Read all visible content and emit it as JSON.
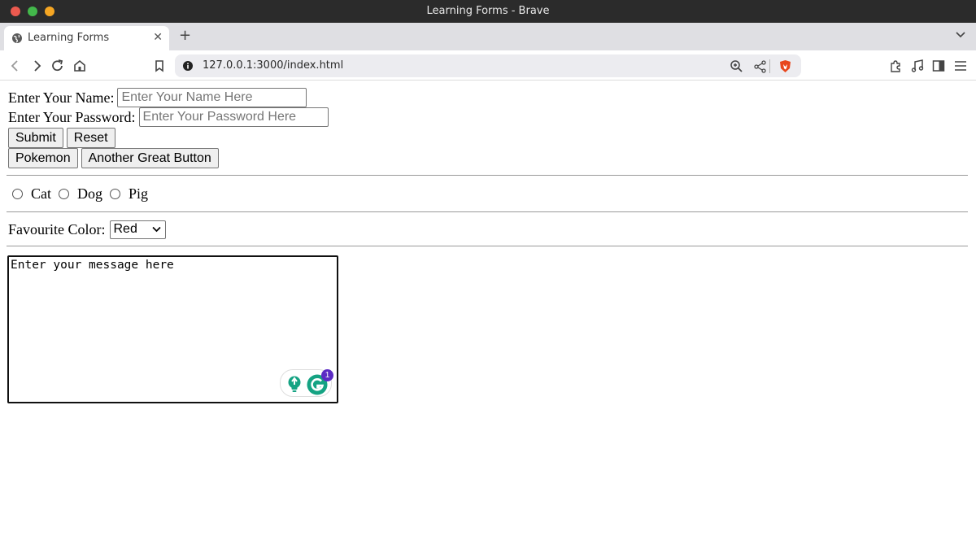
{
  "window": {
    "title": "Learning Forms - Brave"
  },
  "tabs": [
    {
      "label": "Learning Forms",
      "active": true
    }
  ],
  "address_bar": {
    "url": "127.0.0.1:3000/index.html"
  },
  "form": {
    "name_label": "Enter Your Name:",
    "name_placeholder": "Enter Your Name Here",
    "password_label": "Enter Your Password:",
    "password_placeholder": "Enter Your Password Here",
    "submit_label": "Submit",
    "reset_label": "Reset",
    "pokemon_label": "Pokemon",
    "great_button_label": "Another Great Button",
    "pets": [
      "Cat",
      "Dog",
      "Pig"
    ],
    "color_label": "Favourite Color:",
    "color_value": "Red",
    "message_value": "Enter your message here"
  },
  "grammarly": {
    "badge_count": "1",
    "accent_color": "#15a383",
    "badge_color": "#5b2bc4"
  },
  "colors": {
    "titlebar": "#2b2b2b",
    "tabstrip": "#dfdfe3",
    "brave_shield": "#e8471d"
  }
}
